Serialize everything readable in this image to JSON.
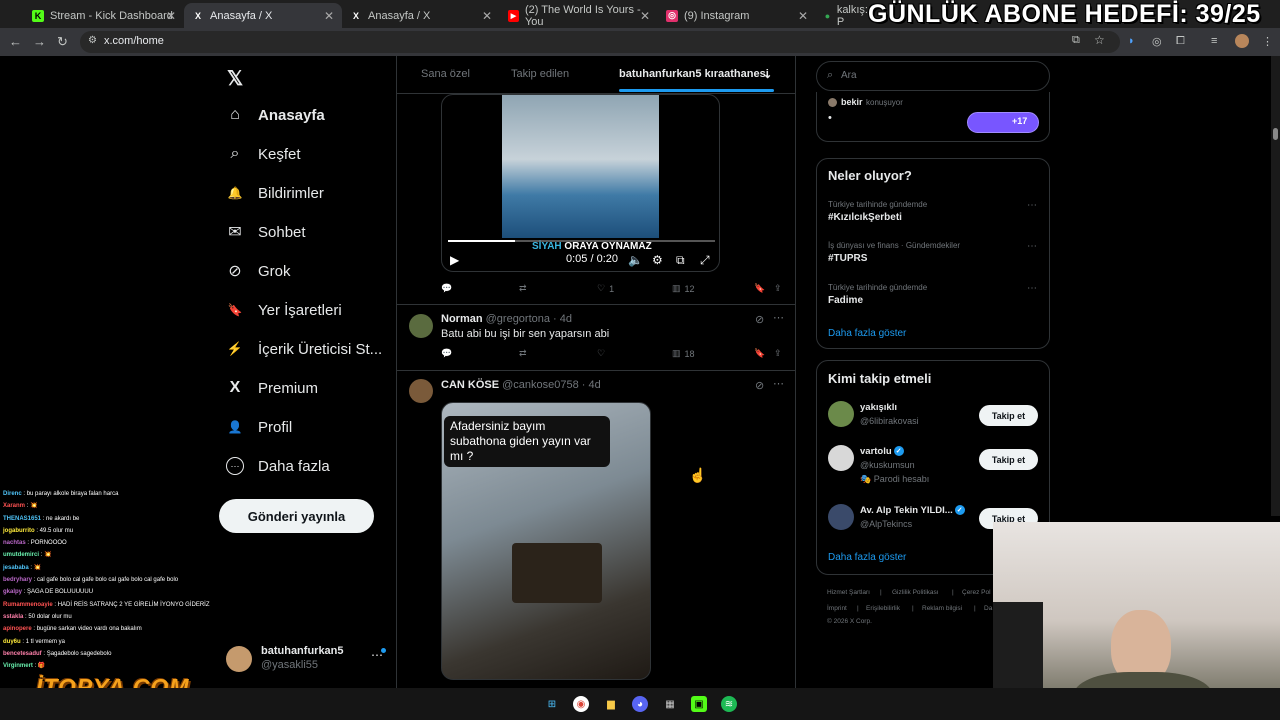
{
  "overlay_title": "GÜNLÜK ABONE HEDEFİ: 39/25",
  "browser": {
    "tabs": [
      {
        "label": "Stream - Kick Dashboard",
        "icon": "K",
        "color": "#53fc18"
      },
      {
        "label": "Anasayfa / X",
        "icon": "X",
        "color": "#ffffff"
      },
      {
        "label": "Anasayfa / X",
        "icon": "X",
        "color": "#ffffff"
      },
      {
        "label": "(2) The World Is Yours - You",
        "icon": "▶",
        "color": "#ff0000"
      },
      {
        "label": "(9) Instagram",
        "icon": "◎",
        "color": "#e1306c"
      },
      {
        "label": "kalkış: P",
        "icon": "●",
        "color": "#34a853"
      }
    ],
    "url": "x.com/home"
  },
  "nav": {
    "items": [
      {
        "label": "Anasayfa",
        "icon": "⌂"
      },
      {
        "label": "Keşfet",
        "icon": "⌕"
      },
      {
        "label": "Bildirimler",
        "icon": "🔔"
      },
      {
        "label": "Sohbet",
        "icon": "✉"
      },
      {
        "label": "Grok",
        "icon": "⊘"
      },
      {
        "label": "Yer İşaretleri",
        "icon": "🔖"
      },
      {
        "label": "İçerik Üreticisi St...",
        "icon": "⚡"
      },
      {
        "label": "Premium",
        "icon": "X"
      },
      {
        "label": "Profil",
        "icon": "👤"
      },
      {
        "label": "Daha fazla",
        "icon": "⋯"
      }
    ],
    "post_button": "Gönderi yayınla",
    "account_name": "batuhanfurkan5",
    "account_handle": "@yasakli55"
  },
  "feed": {
    "tabs": [
      "Sana özel",
      "Takip edilen",
      "batuhanfurkan5 kıraathanesi"
    ],
    "video": {
      "subtitle_hl": "SİYAH",
      "subtitle_rest": " ORAYA OYNAMAZ",
      "time": "0:05 / 0:20",
      "progress": 0.25
    },
    "post1_actions": {
      "likes": "1",
      "views": "12"
    },
    "post2": {
      "name": "Norman",
      "handle": "@gregortona · 4d",
      "text": "Batu abi bu işi bir sen yaparsın abi",
      "views": "18"
    },
    "post3": {
      "name": "CAN KÖSE",
      "handle": "@cankose0758 · 4d",
      "image_caption": "Afadersiniz bayım subathona giden yayın var mı ?"
    }
  },
  "right": {
    "search_placeholder": "Ara",
    "space": {
      "speaker": "bekir",
      "status": "konuşuyor",
      "dot": "•",
      "count": "+17"
    },
    "trends_title": "Neler oluyor?",
    "trends": [
      {
        "category": "Türkiye tarihinde gündemde",
        "name": "#KızılcıkŞerbeti"
      },
      {
        "category": "İş dünyası ve finans · Gündemdekiler",
        "name": "#TUPRS"
      },
      {
        "category": "Türkiye tarihinde gündemde",
        "name": "Fadime"
      }
    ],
    "show_more": "Daha fazla göster",
    "who_title": "Kimi takip etmeli",
    "who": [
      {
        "name": "yakışıklı",
        "handle": "@6libirakovasi",
        "extra": "",
        "verified": false
      },
      {
        "name": "vartolu",
        "handle": "@kuskumsun",
        "extra": "🎭 Parodi hesabı",
        "verified": true
      },
      {
        "name": "Av. Alp Tekin YILDI...",
        "handle": "@AlpTekincs",
        "extra": "",
        "verified": true
      }
    ],
    "follow_label": "Takip et",
    "footer": [
      "Hizmet Şartları",
      "|",
      "Gizlilik Politikası",
      "|",
      "Çerez Pol",
      "İmprint",
      "|",
      "Erişilebilirlik",
      "|",
      "Reklam bilgisi",
      "|",
      "Da",
      "© 2026 X Corp."
    ]
  },
  "chat": [
    {
      "user": "Direnc",
      "color": "#4fc3f7",
      "msg": "bu parayı alkole biraya falan harca"
    },
    {
      "user": "Xaranm",
      "color": "#ff5252",
      "msg": "💥"
    },
    {
      "user": "THENAS1651",
      "color": "#4fc3f7",
      "msg": "ne akardı be"
    },
    {
      "user": "jogaburrito",
      "color": "#ffeb3b",
      "msg": "49.5 olur mu"
    },
    {
      "user": "nachtas",
      "color": "#ba68c8",
      "msg": "PORNOOOO"
    },
    {
      "user": "umutdemirci",
      "color": "#69f0ae",
      "msg": "💥"
    },
    {
      "user": "jesababa",
      "color": "#4fc3f7",
      "msg": "💥"
    },
    {
      "user": "bedryhary",
      "color": "#ba68c8",
      "msg": "cal gafe bolo cal gafe bolo cal gafe bolo cal gafe bolo"
    },
    {
      "user": "gkalpy",
      "color": "#ba68c8",
      "msg": "ŞAGA DE BOLUUUUUU"
    },
    {
      "user": "Rumammenoayie",
      "color": "#ff5252",
      "msg": "HADİ REİS SATRANÇ 2 YE GİRELİM İYONYO GİDERİZ"
    },
    {
      "user": "sstakla",
      "color": "#ff80ab",
      "msg": "50 dolar olur mu"
    },
    {
      "user": "apinopere",
      "color": "#ff5252",
      "msg": "bugüne sarkan video vardı ona bakalım"
    },
    {
      "user": "duy6u",
      "color": "#ffeb3b",
      "msg": "1 tl vermem ya"
    },
    {
      "user": "bencetesaduf",
      "color": "#ff80ab",
      "msg": "Şagadebolo sagedebolo"
    },
    {
      "user": "Virginmert",
      "color": "#69f0ae",
      "msg": "🎁"
    }
  ],
  "logo_text": "İTOPYA.COM",
  "colors": {
    "accent": "#1d9bf0",
    "bg": "#000000",
    "border": "#2f3336"
  }
}
